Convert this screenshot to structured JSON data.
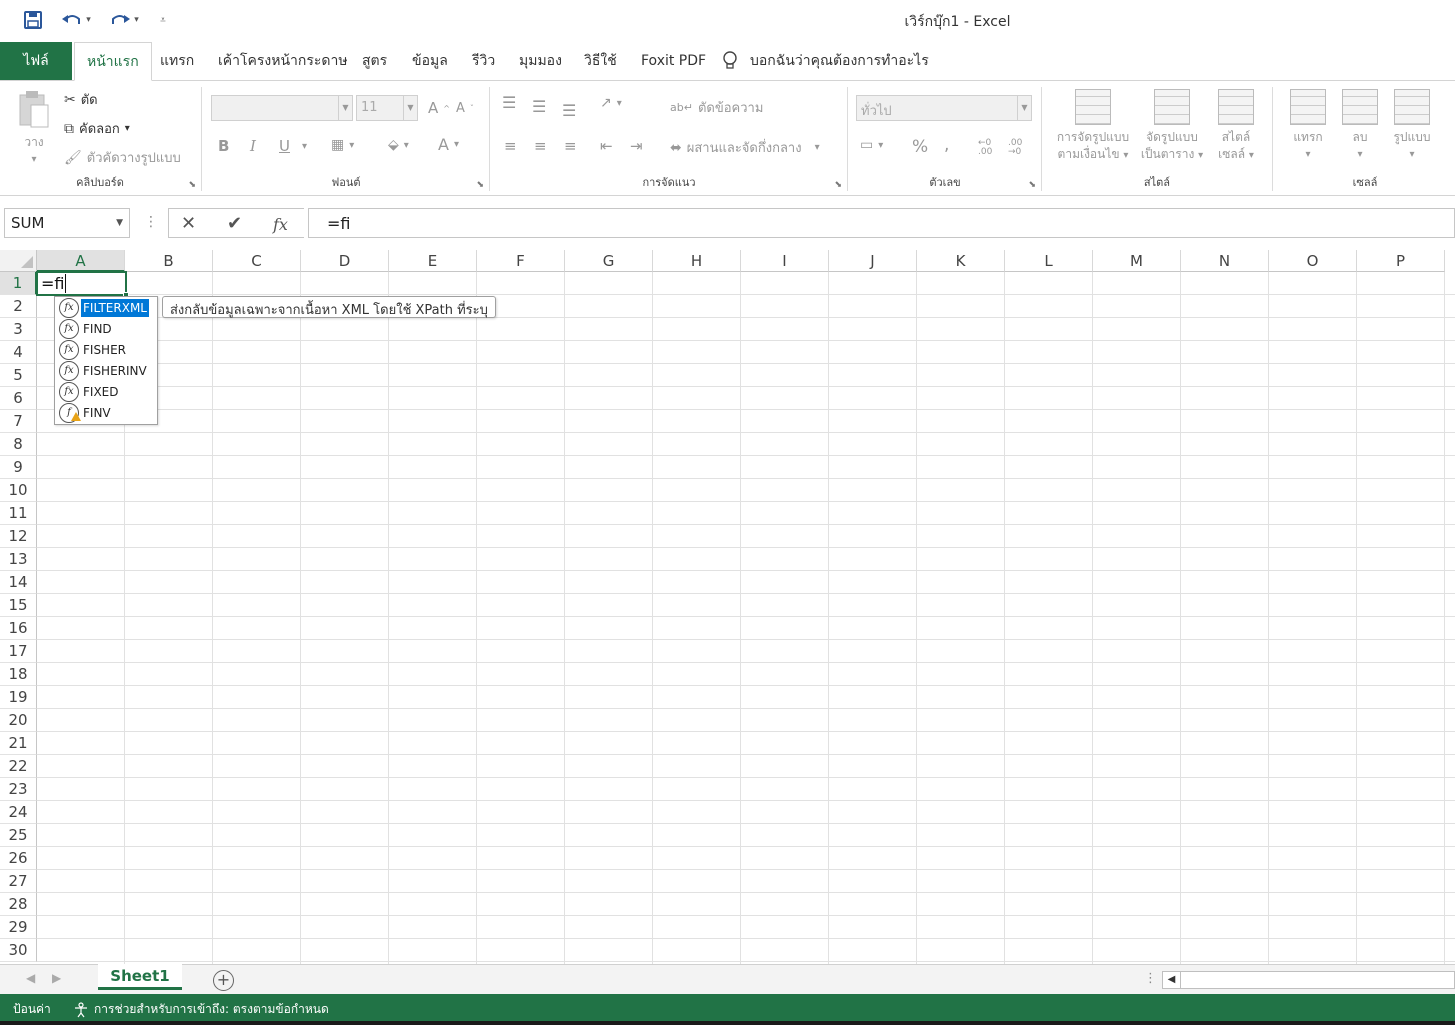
{
  "window": {
    "title": "เวิร์กบุ๊ก1  -  Excel"
  },
  "quick_access": {
    "save_icon": "save-icon",
    "undo_icon": "undo-icon",
    "redo_icon": "redo-icon",
    "customize_icon": "customize-icon"
  },
  "tabs": [
    {
      "label": "ไฟล์"
    },
    {
      "label": "หน้าแรก"
    },
    {
      "label": "แทรก"
    },
    {
      "label": "เค้าโครงหน้ากระดาษ"
    },
    {
      "label": "สูตร"
    },
    {
      "label": "ข้อมูล"
    },
    {
      "label": "รีวิว"
    },
    {
      "label": "มุมมอง"
    },
    {
      "label": "วิธีใช้"
    },
    {
      "label": "Foxit PDF"
    }
  ],
  "tell_me": "บอกฉันว่าคุณต้องการทำอะไร",
  "ribbon": {
    "clipboard": {
      "label": "คลิปบอร์ด",
      "paste": "วาง",
      "cut": "ตัด",
      "copy": "คัดลอก",
      "format_painter": "ตัวคัดวางรูปแบบ"
    },
    "font": {
      "label": "ฟอนต์",
      "font_name": "",
      "font_size": "11",
      "bold": "B",
      "italic": "I",
      "underline": "U"
    },
    "alignment": {
      "label": "การจัดแนว",
      "wrap_text": "ตัดข้อความ",
      "merge_center": "ผสานและจัดกึ่งกลาง"
    },
    "number": {
      "label": "ตัวเลข",
      "format": "ทั่วไป"
    },
    "styles": {
      "label": "สไตล์",
      "conditional_1": "การจัดรูปแบบ",
      "conditional_2": "ตามเงื่อนไข",
      "format_table_1": "จัดรูปแบบ",
      "format_table_2": "เป็นตาราง",
      "cell_styles_1": "สไตล์",
      "cell_styles_2": "เซลล์"
    },
    "cells": {
      "label": "เซลล์",
      "insert": "แทรก",
      "delete": "ลบ",
      "format": "รูปแบบ"
    }
  },
  "formula_bar": {
    "name_box": "SUM",
    "content": "=fi"
  },
  "columns": [
    "A",
    "B",
    "C",
    "D",
    "E",
    "F",
    "G",
    "H",
    "I",
    "J",
    "K",
    "L",
    "M",
    "N",
    "O",
    "P"
  ],
  "rows": [
    "1",
    "2",
    "3",
    "4",
    "5",
    "6",
    "7",
    "8",
    "9",
    "10",
    "11",
    "12",
    "13",
    "14",
    "15",
    "16",
    "17",
    "18",
    "19",
    "20",
    "21",
    "22",
    "23",
    "24",
    "25",
    "26",
    "27",
    "28",
    "29",
    "30"
  ],
  "active_cell": {
    "ref": "A1",
    "content": "=fi"
  },
  "autocomplete": {
    "items": [
      {
        "name": "FILTERXML",
        "selected": true
      },
      {
        "name": "FIND"
      },
      {
        "name": "FISHER"
      },
      {
        "name": "FISHERINV"
      },
      {
        "name": "FIXED"
      },
      {
        "name": "FINV",
        "warning": true
      }
    ],
    "tooltip": "ส่งกลับข้อมูลเฉพาะจากเนื้อหา XML โดยใช้ XPath ที่ระบุ"
  },
  "sheets": [
    {
      "name": "Sheet1",
      "active": true
    }
  ],
  "status": {
    "mode": "ป้อนค่า",
    "accessibility": "การช่วยสำหรับการเข้าถึง: ตรงตามข้อกำหนด"
  },
  "colors": {
    "accent": "#217346",
    "selection": "#0078d7"
  }
}
